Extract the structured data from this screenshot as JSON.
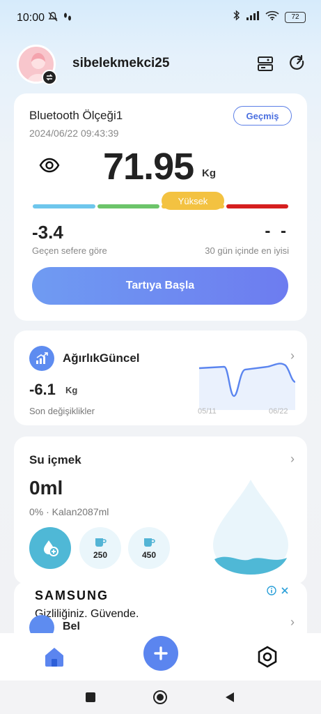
{
  "status_bar": {
    "time": "10:00",
    "battery": "72"
  },
  "header": {
    "username": "sibelekmekci25"
  },
  "scale_card": {
    "device_name": "Bluetooth Ölçeği1",
    "datetime": "2024/06/22 09:43:39",
    "history_label": "Geçmiş",
    "weight": "71.95",
    "unit": "Kg",
    "range_label": "Yüksek",
    "range_colors": [
      "#6ec6ec",
      "#6cc46a",
      "#f3c241",
      "#d61f1f"
    ],
    "change_value": "-3.4",
    "change_caption": "Geçen sefere göre",
    "best_value": "- -",
    "best_caption": "30 gün içinde en iyisi",
    "start_button": "Tartıya Başla"
  },
  "trend_card": {
    "title": "AğırlıkGüncel",
    "value": "-6.1",
    "unit": "Kg",
    "caption": "Son değişiklikler",
    "start_date": "05/11",
    "end_date": "06/22"
  },
  "water_card": {
    "title": "Su içmek",
    "amount": "0ml",
    "status": "0% · Kalan2087ml",
    "cups": [
      "250",
      "450"
    ]
  },
  "ad": {
    "brand": "SAMSUNG",
    "text": "Gizliliğiniz. Güvende.",
    "partial_label": "Bel"
  },
  "colors": {
    "accent": "#5b85ef",
    "water": "#4fb8d6"
  }
}
